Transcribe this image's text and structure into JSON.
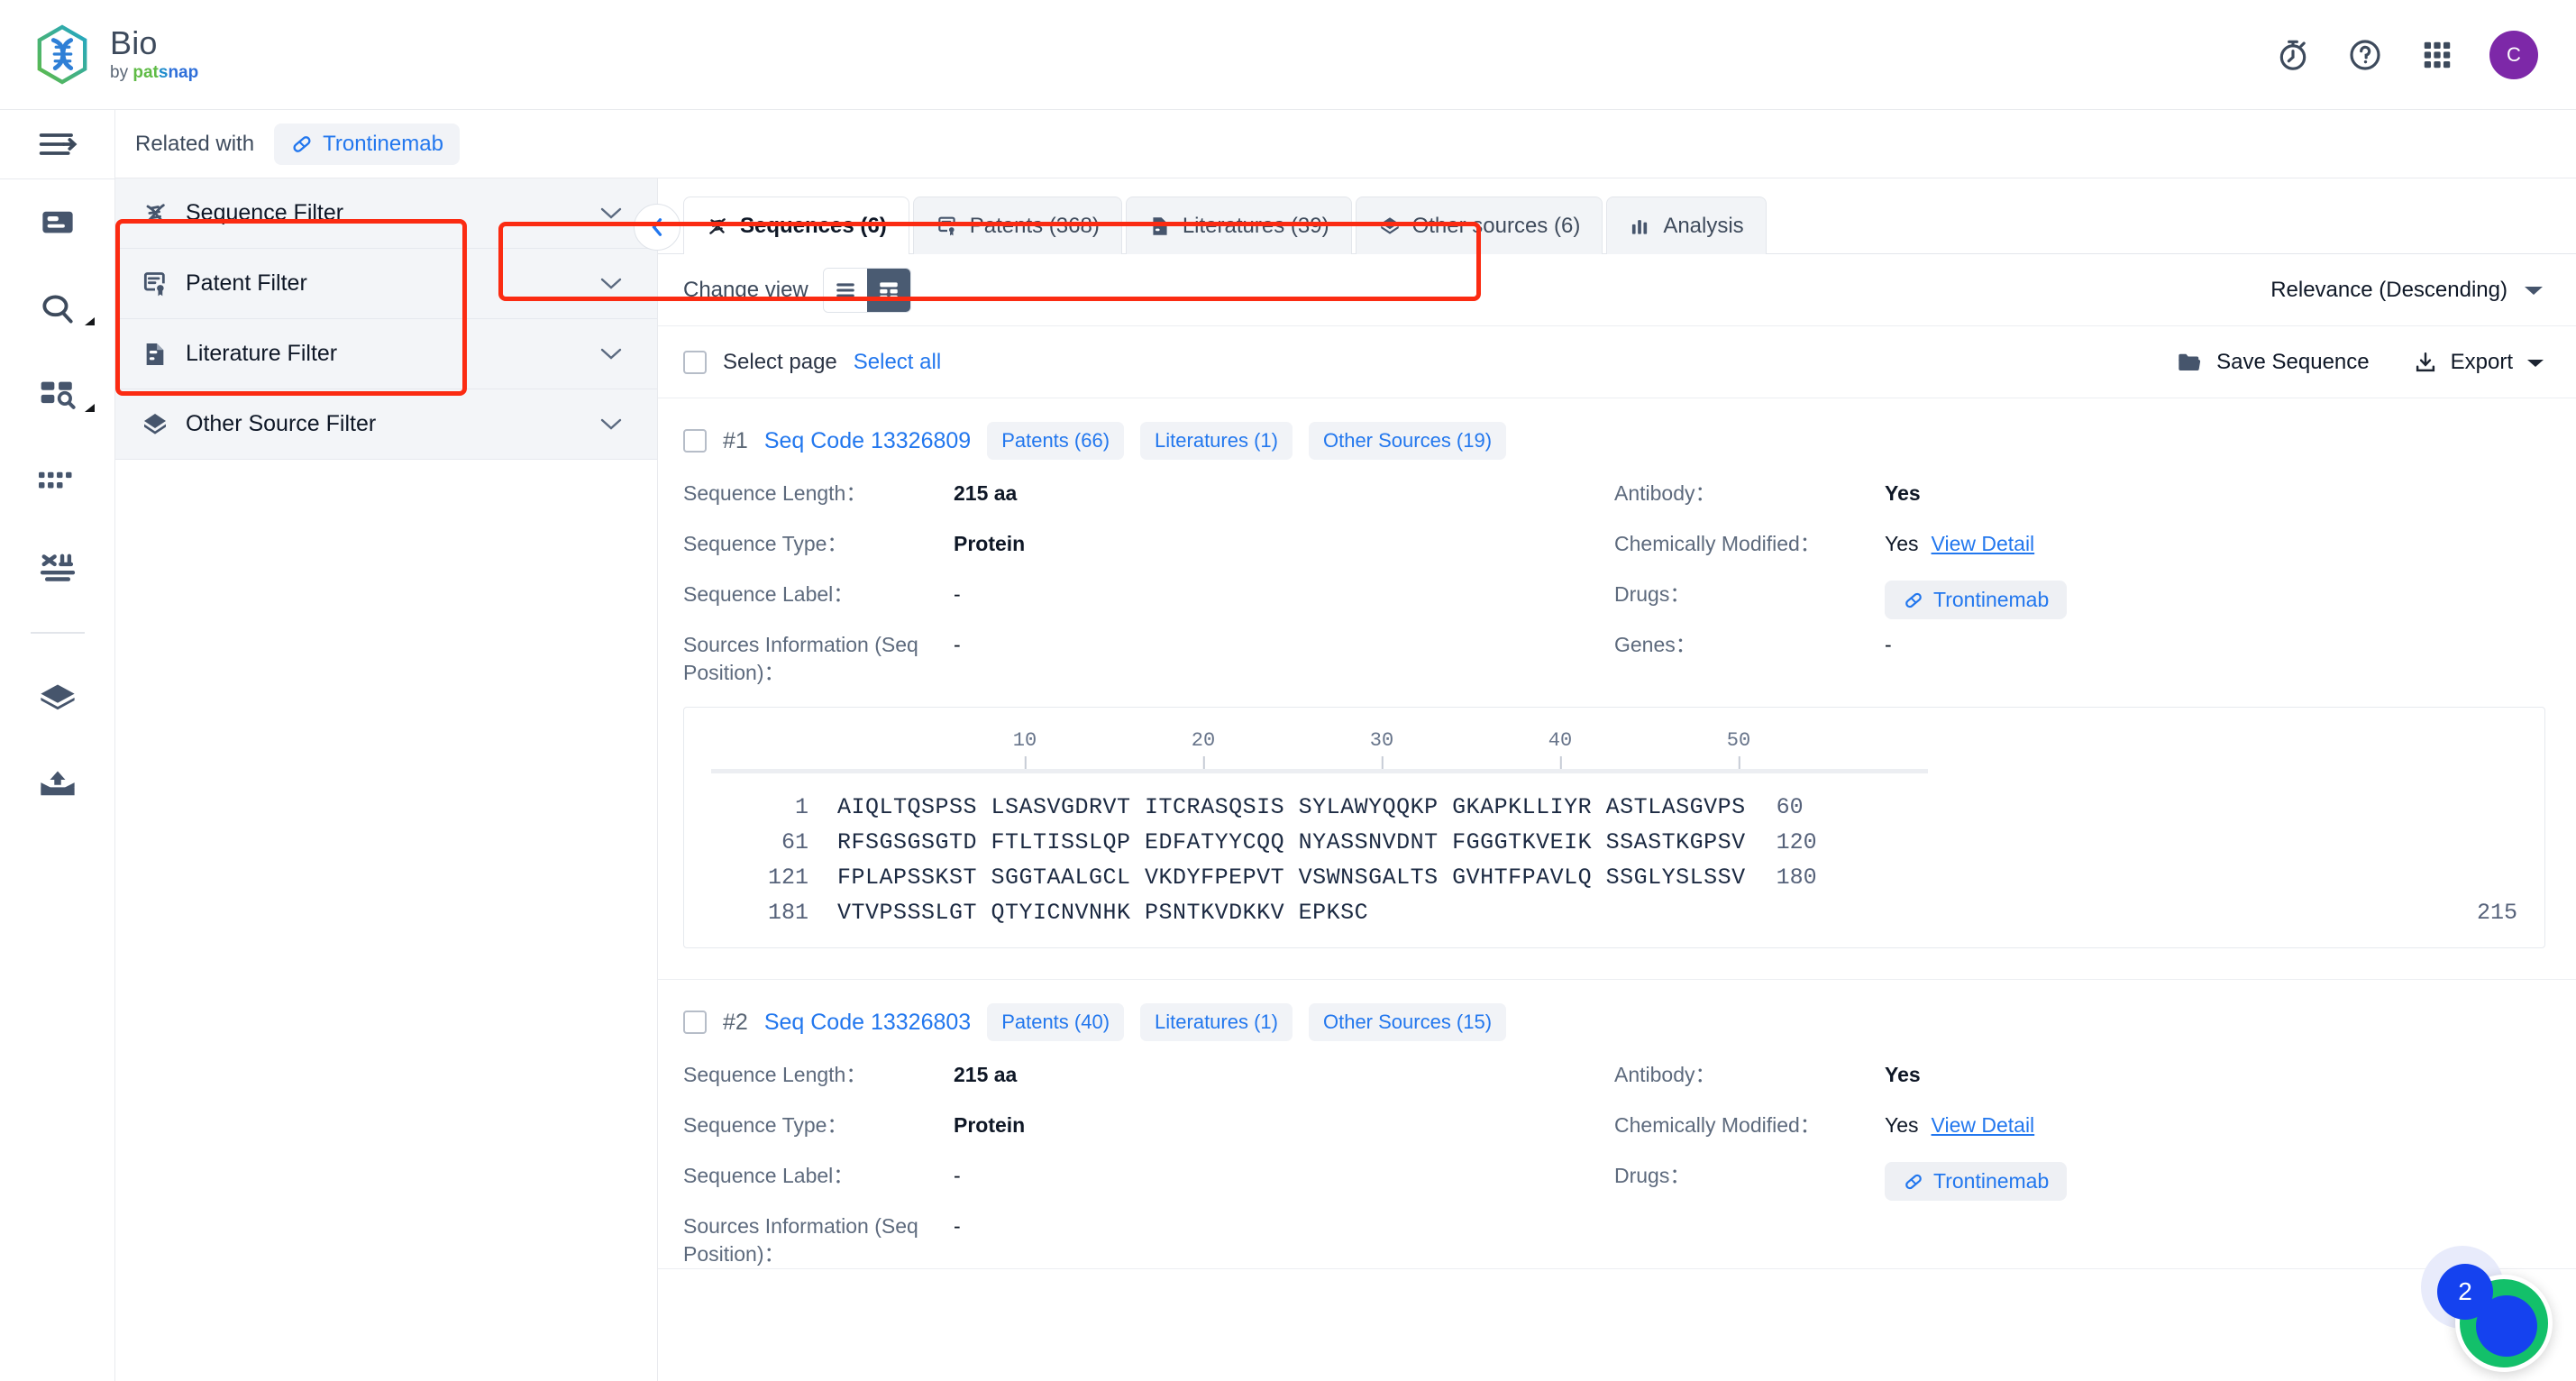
{
  "header": {
    "brand_title": "Bio",
    "brand_by": "by",
    "brand_pat": "pat",
    "brand_s": "s",
    "brand_nap": "nap",
    "icons": {
      "timer": "stopwatch-icon",
      "help": "help-circle-icon",
      "apps": "apps-grid-icon"
    },
    "avatar_initial": "C"
  },
  "rail": {
    "items": [
      {
        "name": "collapse-menu-icon",
        "label": "Collapse menu"
      },
      {
        "name": "document-icon",
        "label": "Documents"
      },
      {
        "name": "search-icon",
        "label": "Search"
      },
      {
        "name": "grid-search-icon",
        "label": "Advanced search"
      },
      {
        "name": "table-icon",
        "label": "Table"
      },
      {
        "name": "tools-icon",
        "label": "Tools"
      },
      {
        "name": "box-icon",
        "label": "Library"
      },
      {
        "name": "upload-icon",
        "label": "Upload"
      }
    ]
  },
  "related": {
    "label": "Related with",
    "chip_label": "Trontinemab",
    "chip_icon": "capsule-icon"
  },
  "filters": {
    "items": [
      {
        "label": "Sequence Filter",
        "icon": "dna-icon"
      },
      {
        "label": "Patent Filter",
        "icon": "patent-certificate-icon"
      },
      {
        "label": "Literature Filter",
        "icon": "document-text-icon"
      },
      {
        "label": "Other Source Filter",
        "icon": "hexagon-box-icon"
      }
    ]
  },
  "tabs": [
    {
      "label": "Sequences (6)",
      "icon": "dna-icon",
      "active": true
    },
    {
      "label": "Patents (368)",
      "icon": "patent-certificate-icon",
      "active": false
    },
    {
      "label": "Literatures (39)",
      "icon": "document-text-icon",
      "active": false
    },
    {
      "label": "Other sources (6)",
      "icon": "hexagon-box-icon",
      "active": false
    },
    {
      "label": "Analysis",
      "icon": "bar-chart-icon",
      "active": false
    }
  ],
  "toolbar": {
    "change_view_label": "Change view",
    "view_list_icon": "list-view-icon",
    "view_card_icon": "card-view-icon",
    "sort_value": "Relevance (Descending)",
    "select_page_label": "Select page",
    "select_all_label": "Select all",
    "save_sequence_label": "Save Sequence",
    "export_label": "Export"
  },
  "field_labels": {
    "sequence_length": "Sequence Length：",
    "sequence_type": "Sequence Type：",
    "sequence_label": "Sequence Label：",
    "sources_information": "Sources Information (Seq Position)：",
    "antibody": "Antibody：",
    "chemically_modified": "Chemically Modified：",
    "drugs": "Drugs：",
    "genes": "Genes：",
    "view_detail": "View Detail"
  },
  "records": [
    {
      "index": "#1",
      "code": "Seq Code 13326809",
      "badges": [
        "Patents (66)",
        "Literatures (1)",
        "Other Sources (19)"
      ],
      "sequence_length": "215 aa",
      "sequence_type": "Protein",
      "sequence_label": "-",
      "sources_information": "-",
      "antibody": "Yes",
      "chemically_modified": "Yes",
      "drugs": "Trontinemab",
      "genes": "-",
      "ruler_ticks": [
        "10",
        "20",
        "30",
        "40",
        "50"
      ],
      "sequence_lines": [
        {
          "start": "1",
          "chars": "AIQLTQSPSS LSASVGDRVT ITCRASQSIS SYLAWYQQKP GKAPKLLIYR ASTLASGVPS",
          "end": "60"
        },
        {
          "start": "61",
          "chars": "RFSGSGSGTD FTLTISSLQP EDFATYYCQQ NYASSNVDNT FGGGTKVEIK SSASTKGPSV",
          "end": "120"
        },
        {
          "start": "121",
          "chars": "FPLAPSSKST SGGTAALGCL VKDYFPEPVT VSWNSGALTS GVHTFPAVLQ SSGLYSLSSV",
          "end": "180"
        },
        {
          "start": "181",
          "chars": "VTVPSSSLGT QTYICNVNHK PSNTKVDKKV EPKSC",
          "end": "215"
        }
      ]
    },
    {
      "index": "#2",
      "code": "Seq Code 13326803",
      "badges": [
        "Patents (40)",
        "Literatures (1)",
        "Other Sources (15)"
      ],
      "sequence_length": "215 aa",
      "sequence_type": "Protein",
      "sequence_label": "-",
      "sources_information": "-",
      "antibody": "Yes",
      "chemically_modified": "Yes",
      "drugs": "Trontinemab",
      "genes": "-"
    }
  ],
  "fab": {
    "count": "2",
    "name": "support-widget"
  },
  "colors": {
    "link": "#2277ee",
    "annotation": "#fb2b12",
    "avatar": "#7d28a8",
    "fab_green": "#13c06a",
    "fab_blue": "#1542ef"
  }
}
